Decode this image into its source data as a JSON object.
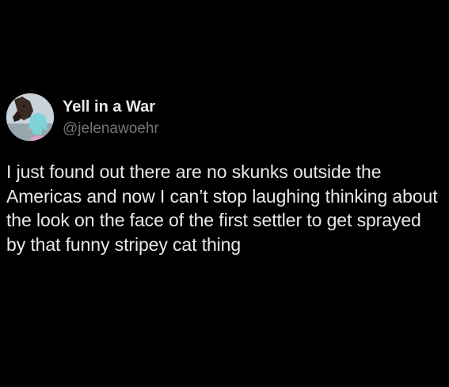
{
  "tweet": {
    "author": {
      "display_name": "Yell in a War",
      "handle": "@jelenawoehr",
      "avatar_icon": "profile-photo-person-with-horse"
    },
    "text": "I just found out there are no skunks outside the Americas and now I can’t stop laughing thinking about the look on the face of the first settler to get sprayed by that funny stripey cat thing"
  },
  "colors": {
    "background": "#000000",
    "primary_text": "#e7e9ea",
    "secondary_text": "#71767b"
  }
}
